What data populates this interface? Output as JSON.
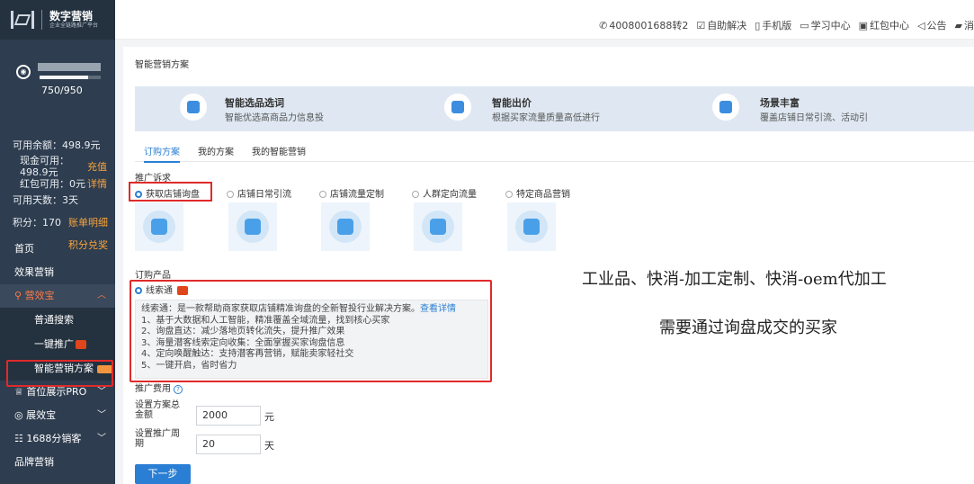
{
  "brand": {
    "title": "数字营销",
    "subtitle": "企业全链路推广平台"
  },
  "account": {
    "score_ratio": "750/950",
    "available_balance": "可用余额：498.9元",
    "cash_available_label": "现金可用：",
    "cash_available_value": "498.9元",
    "recharge_link": "充值",
    "redpacket_available": "红包可用：0元",
    "details_link": "详情",
    "available_days": "可用天数：3天",
    "points": "积分：170",
    "bill_link": "账单明细",
    "points_exchange_link": "积分兑奖",
    "level_fraction": 0.79
  },
  "nav": {
    "home": "首页",
    "effect_marketing": "效果营销",
    "yingxiaobao": "营效宝",
    "normal_search": "普通搜索",
    "one_click": "一键推广",
    "smart_plan": "智能营销方案",
    "top_display": "首位展示PRO",
    "zhanxiaobao": "展效宝",
    "distribution": "1688分销客",
    "brand_marketing": "品牌营销"
  },
  "topbar": {
    "phone": "4008001688转2",
    "self_help": "自助解决",
    "mobile": "手机版",
    "learning": "学习中心",
    "redpacket_center": "红包中心",
    "notice": "公告",
    "message_cut": "消"
  },
  "page": {
    "breadcrumb": "智能营销方案",
    "features": [
      {
        "title": "智能选品选词",
        "desc": "智能优选高商品力信息投"
      },
      {
        "title": "智能出价",
        "desc": "根据买家流量质量高低进行"
      },
      {
        "title": "场景丰富",
        "desc": "覆盖店铺日常引流、活动引"
      }
    ],
    "tabs": [
      "订购方案",
      "我的方案",
      "我的智能营销"
    ],
    "promo_type_label": "推广诉求",
    "promo_types": [
      "获取店铺询盘",
      "店铺日常引流",
      "店铺流量定制",
      "人群定向流量",
      "特定商品营销"
    ],
    "product_label": "订购产品",
    "product_name": "线索通",
    "product_desc": {
      "intro": "线索通：是一款帮助商家获取店铺精准询盘的全新智投行业解决方案。",
      "link": "查看详情",
      "points": [
        "1、基于大数据和人工智能，精准覆盖全域流量，找到核心买家",
        "2、询盘直达：减少落地页转化流失，提升推广效果",
        "3、海量潜客线索定向收集：全面掌握买家询盘信息",
        "4、定向唤醒触达：支持潜客再营销，赋能卖家轻社交",
        "5、一键开启，省时省力"
      ]
    },
    "fee_label": "推广费用",
    "total_label_1": "设置方案总",
    "total_label_2": "金额",
    "total_value": "2000",
    "total_unit": "元",
    "period_label_1": "设置推广周",
    "period_label_2": "期",
    "period_value": "20",
    "period_unit": "天",
    "next_button": "下一步"
  },
  "annotation": {
    "line1": "工业品、快消-加工定制、快消-oem代加工",
    "line2": "需要通过询盘成交的买家"
  },
  "colors": {
    "sidebar": "#2e3d4f",
    "accent": "#2a7fd4",
    "highlight": "#e02a2a",
    "link_orange": "#f9a43c"
  }
}
